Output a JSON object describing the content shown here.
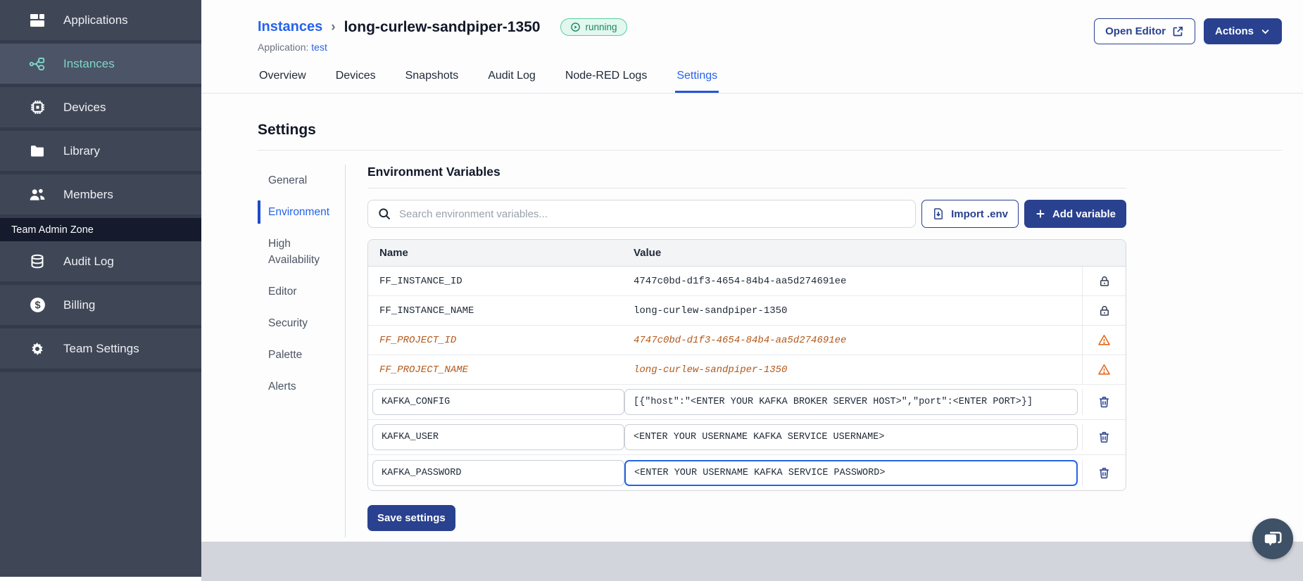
{
  "sidebar": {
    "items": [
      {
        "label": "Applications",
        "icon": "applications-icon"
      },
      {
        "label": "Instances",
        "icon": "instances-icon",
        "active": true
      },
      {
        "label": "Devices",
        "icon": "devices-icon"
      },
      {
        "label": "Library",
        "icon": "library-icon"
      },
      {
        "label": "Members",
        "icon": "members-icon"
      }
    ],
    "section_label": "Team Admin Zone",
    "admin_items": [
      {
        "label": "Audit Log",
        "icon": "audit-log-icon"
      },
      {
        "label": "Billing",
        "icon": "billing-icon"
      },
      {
        "label": "Team Settings",
        "icon": "team-settings-icon"
      }
    ]
  },
  "header": {
    "breadcrumb_root": "Instances",
    "breadcrumb_separator": "›",
    "instance_name": "long-curlew-sandpiper-1350",
    "status_badge": "running",
    "application_label": "Application:",
    "application_name": "test",
    "open_editor_label": "Open Editor",
    "actions_label": "Actions"
  },
  "tabs": [
    {
      "label": "Overview"
    },
    {
      "label": "Devices"
    },
    {
      "label": "Snapshots"
    },
    {
      "label": "Audit Log"
    },
    {
      "label": "Node-RED Logs"
    },
    {
      "label": "Settings",
      "active": true
    }
  ],
  "settings": {
    "page_title": "Settings",
    "nav": [
      {
        "label": "General"
      },
      {
        "label": "Environment",
        "active": true
      },
      {
        "label": "High Availability"
      },
      {
        "label": "Editor"
      },
      {
        "label": "Security"
      },
      {
        "label": "Palette"
      },
      {
        "label": "Alerts"
      }
    ]
  },
  "environment": {
    "section_title": "Environment Variables",
    "search_placeholder": "Search environment variables...",
    "import_button": "Import .env",
    "add_button": "Add variable",
    "save_button": "Save settings",
    "table": {
      "columns": {
        "name": "Name",
        "value": "Value"
      },
      "rows": [
        {
          "name": "FF_INSTANCE_ID",
          "value": "4747c0bd-d1f3-4654-84b4-aa5d274691ee",
          "state": "locked",
          "icon": "lock-icon"
        },
        {
          "name": "FF_INSTANCE_NAME",
          "value": "long-curlew-sandpiper-1350",
          "state": "locked",
          "icon": "lock-icon"
        },
        {
          "name": "FF_PROJECT_ID",
          "value": "4747c0bd-d1f3-4654-84b4-aa5d274691ee",
          "state": "deprecated",
          "icon": "warning-icon"
        },
        {
          "name": "FF_PROJECT_NAME",
          "value": "long-curlew-sandpiper-1350",
          "state": "deprecated",
          "icon": "warning-icon"
        },
        {
          "name": "KAFKA_CONFIG",
          "value": "[{\"host\":\"<ENTER YOUR KAFKA BROKER SERVER HOST>\",\"port\":<ENTER PORT>}]",
          "state": "editable",
          "icon": "trash-icon"
        },
        {
          "name": "KAFKA_USER",
          "value": "<ENTER YOUR USERNAME KAFKA SERVICE USERNAME>",
          "state": "editable",
          "icon": "trash-icon"
        },
        {
          "name": "KAFKA_PASSWORD",
          "value": "<ENTER YOUR USERNAME KAFKA SERVICE PASSWORD>",
          "state": "editable",
          "focused": true,
          "icon": "trash-icon"
        }
      ]
    }
  },
  "colors": {
    "brand_navy": "#29418F",
    "link_blue": "#2563EB",
    "sidebar_bg": "#3F4757",
    "sidebar_active_bg": "#4C5467",
    "sidebar_teal": "#7ED6C6",
    "admin_band_bg": "#151A2C",
    "badge_green_bg": "#E2F8EE",
    "badge_green_border": "#5ACD9E",
    "badge_green_text": "#1B8564",
    "deprecated_orange": "#B3591B",
    "warning_orange": "#E06A1F",
    "footer_gray": "#D2D5DB",
    "chat_circle": "#3E5166"
  }
}
